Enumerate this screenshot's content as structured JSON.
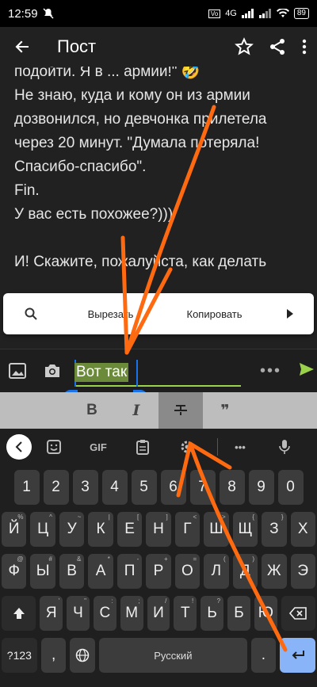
{
  "status": {
    "time": "12:59",
    "signal": "4G",
    "battery": "89"
  },
  "app_bar": {
    "title": "Пост"
  },
  "post": {
    "lines": [
      "подойти. Я в ... армии!\" 🤣",
      "Не знаю, куда и кому он из армии",
      "дозвонился, но девчонка прилетела",
      "через 20 минут. \"Думала потеряла!",
      "Спасибо-спасибо\".",
      "Fin.",
      "У вас есть похожее?)))"
    ],
    "after_gap": "И! Скажите, пожалуйста,  как делать"
  },
  "context_menu": {
    "cut": "Вырезать",
    "copy": "Копировать"
  },
  "composer": {
    "selected_text": "Вот так",
    "dots": "•••"
  },
  "format_bar": {
    "bold": "B",
    "italic": "I",
    "quote": "❞"
  },
  "kb_toolbar": {
    "gif": "GIF",
    "dots": "•••"
  },
  "keyboard": {
    "numbers": [
      "1",
      "2",
      "3",
      "4",
      "5",
      "6",
      "7",
      "8",
      "9",
      "0"
    ],
    "row1": [
      [
        "Й",
        "%"
      ],
      [
        "Ц",
        "^"
      ],
      [
        "У",
        "~"
      ],
      [
        "К",
        "|"
      ],
      [
        "Е",
        "["
      ],
      [
        "Н",
        "]"
      ],
      [
        "Г",
        "<"
      ],
      [
        "Ш",
        ">"
      ],
      [
        "Щ",
        "{"
      ],
      [
        "З",
        "}"
      ],
      [
        "Х",
        ""
      ]
    ],
    "row2": [
      [
        "Ф",
        "@"
      ],
      [
        "Ы",
        "#"
      ],
      [
        "В",
        "&"
      ],
      [
        "А",
        "*"
      ],
      [
        "П",
        "-"
      ],
      [
        "Р",
        "+"
      ],
      [
        "О",
        "="
      ],
      [
        "Л",
        "("
      ],
      [
        "Д",
        ")"
      ],
      [
        "Ж",
        ""
      ],
      [
        "Э",
        ""
      ]
    ],
    "row3": [
      [
        "Я",
        "'"
      ],
      [
        "Ч",
        "\""
      ],
      [
        "С",
        ":"
      ],
      [
        "М",
        ";"
      ],
      [
        "И",
        "/"
      ],
      [
        "Т",
        "!"
      ],
      [
        "Ь",
        "?"
      ],
      [
        "Б",
        ""
      ],
      [
        "Ю",
        ""
      ]
    ],
    "sym_label": "?123",
    "comma": ",",
    "space": "Русский",
    "period": "."
  }
}
